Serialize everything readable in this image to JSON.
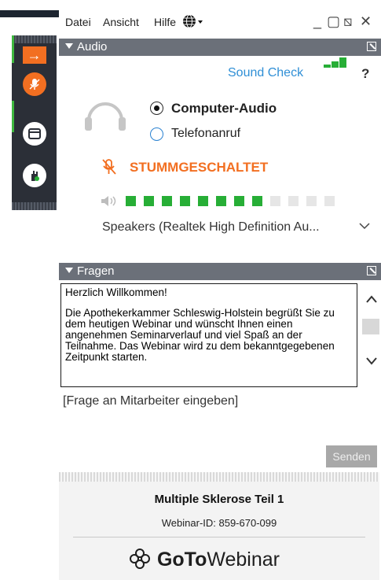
{
  "menu": {
    "items": [
      "Datei",
      "Ansicht",
      "Hilfe"
    ],
    "language_icon": "globe-icon"
  },
  "window_controls": {
    "minimize": "_",
    "restore": "▢",
    "popout": "⧅",
    "close": "✕"
  },
  "audio": {
    "header": "Audio",
    "sound_check": "Sound Check",
    "help": "?",
    "option_computer": "Computer-Audio",
    "option_phone": "Telefonanruf",
    "selected": "Computer-Audio",
    "mute_status": "STUMMGESCHALTET",
    "volume_level": 0.67,
    "device": "Speakers (Realtek High Definition Au..."
  },
  "questions": {
    "header": "Fragen",
    "welcome": "Herzlich Willkommen!",
    "message": "Die Apothekerkammer Schleswig-Holstein begrüßt Sie zu dem heutigen Webinar und wünscht Ihnen einen angenehmen Seminarverlauf und viel Spaß an der Teilnahme. Das Webinar wird zu dem bekanntgegebenen Zeitpunkt starten.",
    "input_placeholder": "[Frage an Mitarbeiter eingeben]",
    "send_label": "Senden"
  },
  "footer": {
    "title": "Multiple Sklerose Teil 1",
    "webinar_id": "Webinar-ID: 859-670-099",
    "brand_bold": "GoTo",
    "brand_regular": "Webinar"
  },
  "colors": {
    "accent_orange": "#f26f21",
    "link_blue": "#2f8fd6",
    "green": "#27ae36"
  }
}
